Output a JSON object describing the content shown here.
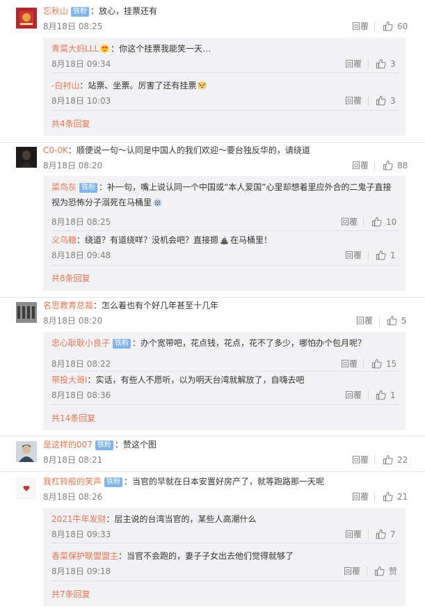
{
  "reply_label": "回覆",
  "fan_badge": "铁粉",
  "threads": [
    {
      "user": "忘秋山",
      "badge": true,
      "text": "：放心，挂票还有",
      "time": "8月18日 08:25",
      "likes": "60",
      "replies": [
        {
          "user": "青菜大妈LLL",
          "emoji": "heart-eyes",
          "text": "：你这个挂票我能笑一天…",
          "time": "8月18日 09:34",
          "likes": "3"
        },
        {
          "user": "-白衬山",
          "text": "：站票、坐票。厉害了还有挂票",
          "emoji_after": "dog",
          "time": "8月18日 10:03",
          "likes": "3"
        }
      ],
      "more": "共4条回复"
    },
    {
      "user": "C0-0K",
      "badge": false,
      "text": "：顺便说一句～认同是中国人的我们欢迎～要台独反华的，请绕道",
      "time": "8月18日 08:20",
      "likes": "88",
      "replies": [
        {
          "user": "菜鸟灰",
          "badge": true,
          "text": "：补一句，嘴上说认同一个中国或“本人爱国”心里却想着里应外合的二鬼子直接视为恐怖分子溺死在马桶里",
          "emoji_after": "cry",
          "time": "8月18日 08:25",
          "likes": "10"
        },
        {
          "user": "义乌糖",
          "text": "：绕道？有道绕咩？没机会吧？直接摁",
          "emoji_after": "poop",
          "text2": "在马桶里！",
          "time": "8月18日 09:48",
          "likes": "1"
        }
      ],
      "more": "共8条回复"
    },
    {
      "user": "名思教育总裁",
      "badge": false,
      "text": "：怎么着也有个好几年甚至十几年",
      "time": "8月18日 08:20",
      "likes": "5",
      "replies": [
        {
          "user": "忠心耿耿小良子",
          "badge": true,
          "text": "：办个宽带吧，花点钱，花点，花不了多少，哪怕办个包月呢？",
          "time": "8月18日 08:22",
          "likes": "15"
        },
        {
          "user": "带投大哥I",
          "text": "：实话，有些人不愿听，以为明天台湾就解放了，自嗨去吧",
          "time": "8月18日 08:36",
          "likes": "1"
        }
      ],
      "more": "共14条回复"
    },
    {
      "user": "是这样的007",
      "badge": true,
      "text": "：赞这个图",
      "time": "8月18日 08:21",
      "likes": "22",
      "replies": [],
      "more": ""
    },
    {
      "user": "我杠铃般的笑声",
      "badge": true,
      "text": "：当官的早就在日本安置好房产了，就等跑路那一天呢",
      "time": "8月18日 08:26",
      "likes": "21",
      "replies": [
        {
          "user": "2021牛年发财",
          "text": "：层主说的台湾当官的，某些人高潮什么",
          "time": "8月18日 09:33",
          "likes": "7"
        },
        {
          "user": "香菜保护联盟盟主",
          "text": "：当官不会跑的，妻子子女出去他们觉得就够了",
          "time": "8月18日 09:18",
          "likes": "赞"
        }
      ],
      "more": "共7条回复"
    }
  ]
}
